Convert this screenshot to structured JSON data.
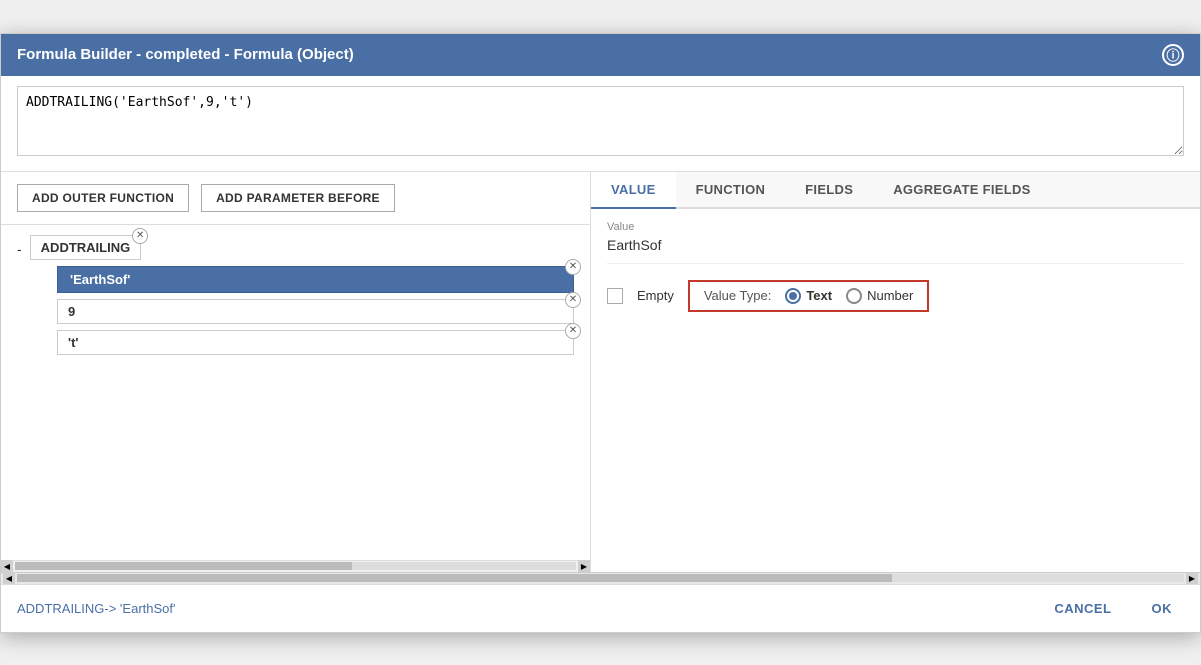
{
  "dialog": {
    "title": "Formula Builder - completed - Formula (Object)",
    "info_icon": "ⓘ"
  },
  "formula": {
    "text": "ADDTRAILING('EarthSof',9,'t')"
  },
  "left_toolbar": {
    "add_outer_function_label": "ADD OUTER FUNCTION",
    "add_parameter_before_label": "ADD PARAMETER BEFORE"
  },
  "tree": {
    "dash": "-",
    "root_node": "ADDTRAILING",
    "children": [
      {
        "label": "'EarthSof'",
        "is_primary": true
      },
      {
        "label": "9",
        "is_primary": false
      },
      {
        "label": "'t'",
        "is_primary": false
      }
    ]
  },
  "tabs": [
    {
      "id": "value",
      "label": "VALUE",
      "active": true
    },
    {
      "id": "function",
      "label": "FUNCTION",
      "active": false
    },
    {
      "id": "fields",
      "label": "FIELDS",
      "active": false
    },
    {
      "id": "aggregate_fields",
      "label": "AGGREGATE FIELDS",
      "active": false
    }
  ],
  "value_panel": {
    "value_label": "Value",
    "value_text": "EarthSof",
    "empty_label": "Empty",
    "value_type_label": "Value Type:",
    "type_text": "Text",
    "type_number": "Number",
    "selected_type": "text"
  },
  "footer": {
    "path": "ADDTRAILING-> 'EarthSof'",
    "cancel_label": "CANCEL",
    "ok_label": "OK"
  }
}
